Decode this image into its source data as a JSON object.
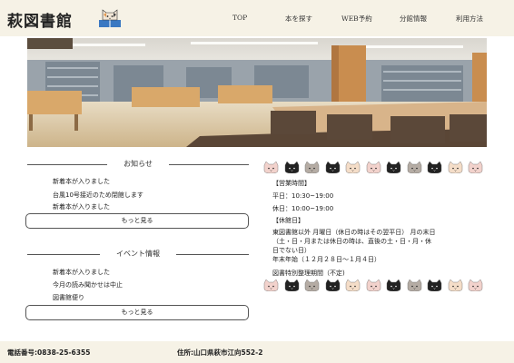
{
  "header": {
    "logo": "萩図書館",
    "nav": [
      "TOP",
      "本を探す",
      "WEB予約",
      "分館情報",
      "利用方法"
    ]
  },
  "news": {
    "title": "お知らせ",
    "items": [
      "新着本が入りました",
      "台風10号接近のため閉館します",
      "新着本が入りました"
    ],
    "more": "もっと見る"
  },
  "events": {
    "title": "イベント情報",
    "items": [
      "新着本が入りました",
      "今月の読み聞かせは中止",
      "図書館便り"
    ],
    "more": "もっと見る"
  },
  "hours": {
    "heading": "【営業時間】",
    "weekday": "平日：10:30~19:00",
    "holiday": "休日：10:00~19:00",
    "closed_heading": "【休館日】",
    "closed_1": "東図書館以外 月曜日（休日の時はその翌平日） 月の末日",
    "closed_2": "（土・日・月または休日の時は、直後の土・日・月・休",
    "closed_3": "日でない日）",
    "closed_4": "年末年始（１２月２８日～１月４日）",
    "closed_5": "図書特別整理期間（不定)"
  },
  "footer": {
    "tel": "電話番号:0838-25-6355",
    "address": "住所:山口県萩市江向552-2"
  },
  "colors": {
    "header_bg": "#f6f2e6",
    "cat_cream": "#f4ddc8",
    "cat_black": "#222222",
    "cat_grey": "#b5aca4",
    "cat_pink": "#f2d2cc"
  }
}
